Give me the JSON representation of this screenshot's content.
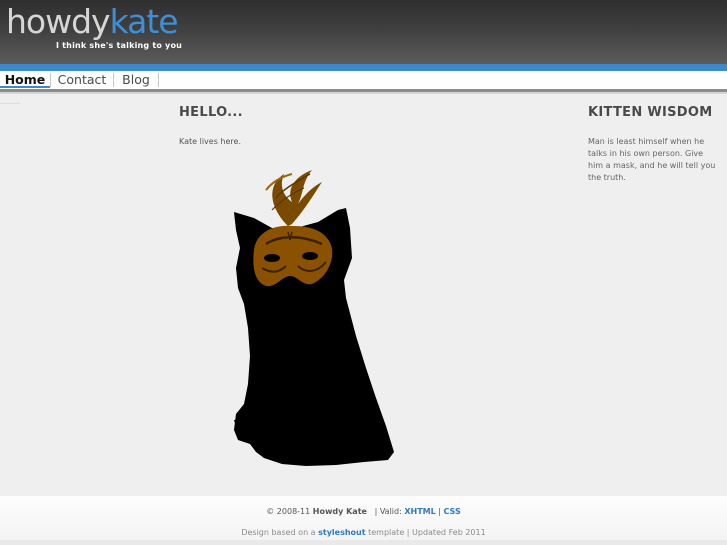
{
  "header": {
    "logo_first": "howdy",
    "logo_second": "kate",
    "tagline": "I think she's talking to you"
  },
  "nav": {
    "items": [
      {
        "label": "Home",
        "active": true
      },
      {
        "label": "Contact",
        "active": false
      },
      {
        "label": "Blog",
        "active": false
      }
    ]
  },
  "main": {
    "heading": "HELLO...",
    "text": "Kate lives here.",
    "image": "masked-cat-illustration"
  },
  "sidebar": {
    "heading": "KITTEN WISDOM",
    "quote": "Man is least himself when he talks in his own person. Give him a mask, and he will tell you the truth."
  },
  "footer": {
    "copyright": "© 2008-11",
    "site_name": "Howdy Kate",
    "valid_label": "| Valid:",
    "xhtml": "XHTML",
    "separator": "|",
    "css": "CSS",
    "design_prefix": "Design based on a",
    "styleshout": "styleshout",
    "design_suffix": "template | Updated Feb 2011"
  },
  "colors": {
    "accent": "#3e88cc",
    "header_dark": "#2f2f2f",
    "page_bg": "#efefef",
    "link": "#2d78c2",
    "mask": "#8a5200"
  }
}
